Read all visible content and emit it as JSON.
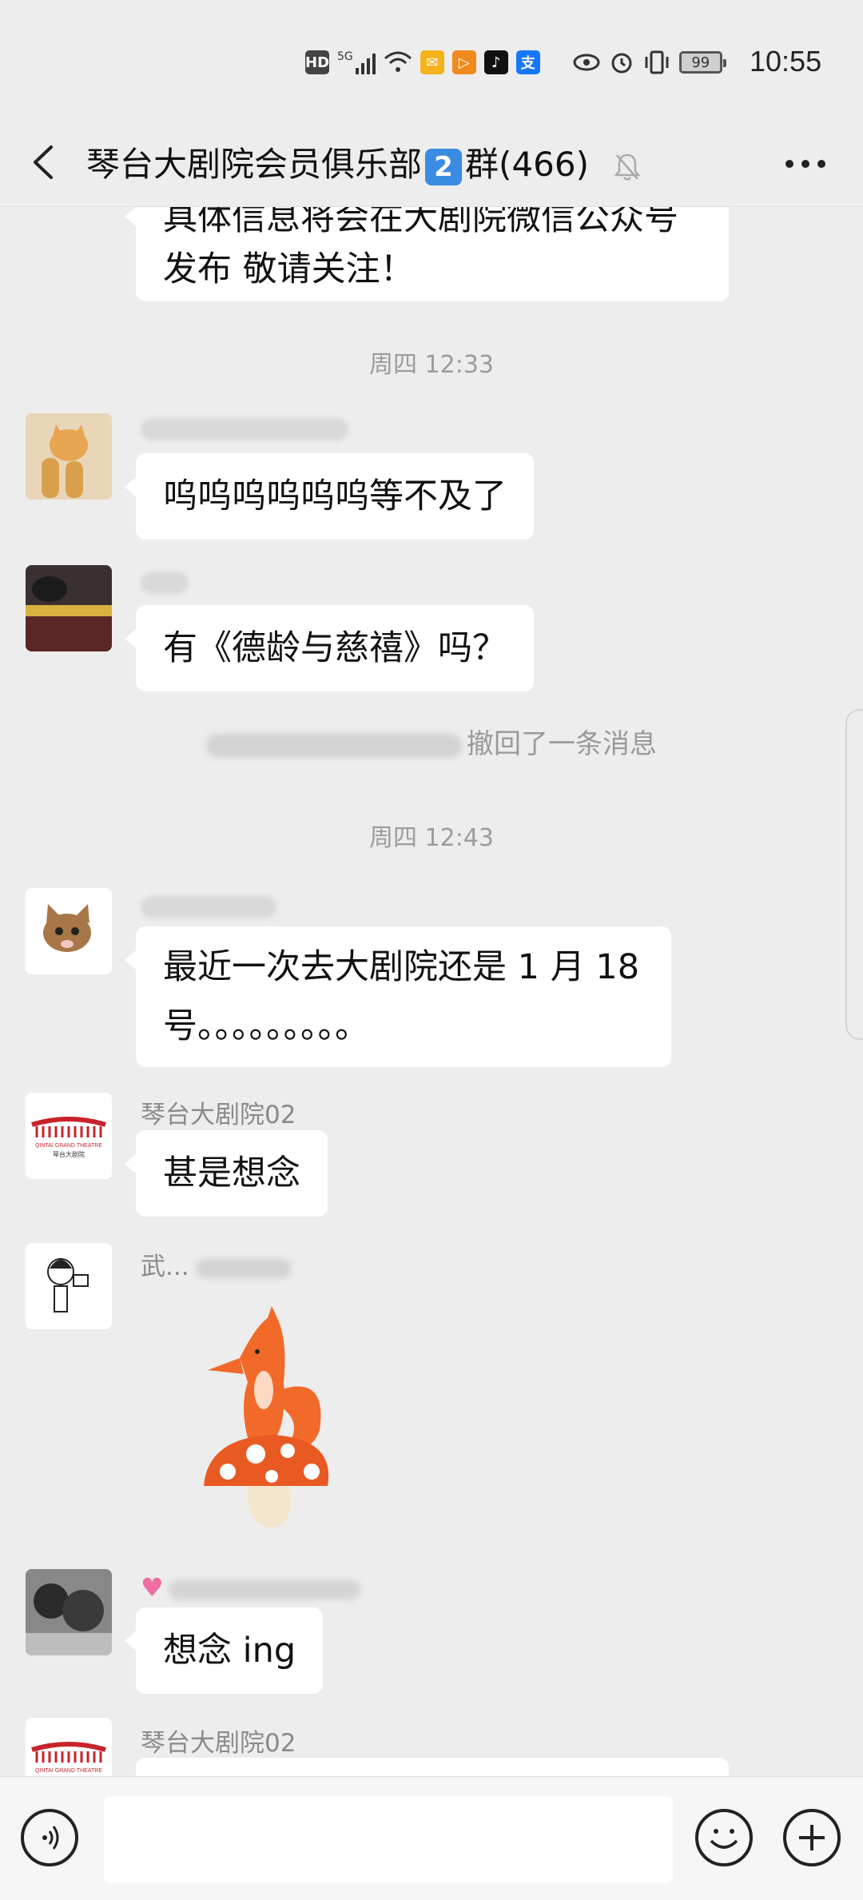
{
  "status_bar": {
    "hd": "HD",
    "net": "5G",
    "battery": "99",
    "time": "10:55",
    "app_icons": [
      "wifi-icon",
      "mail-icon",
      "video-icon",
      "tiktok-icon",
      "alipay-icon",
      "eye-icon",
      "alarm-icon",
      "vibrate-icon"
    ]
  },
  "header": {
    "title_prefix": "琴台大剧院会员俱乐部",
    "badge": "2",
    "title_suffix": "群(466)"
  },
  "messages": {
    "m0": {
      "text_line1": "具体信息将会在大剧院微信公众号",
      "text_line2": "发布 敬请关注！"
    },
    "t1": "周四 12:33",
    "m1": {
      "text": "呜呜呜呜呜呜等不及了"
    },
    "m2": {
      "text": "有《德龄与慈禧》吗？"
    },
    "recall": "撤回了一条消息",
    "t2": "周四 12:43",
    "m3": {
      "text_line1": "最近一次去大剧院还是 1 月 18",
      "text_line2": "号。。。。。。。。。"
    },
    "m4": {
      "name": "琴台大剧院02",
      "text": "甚是想念"
    },
    "m5": {
      "name_prefix": "武..."
    },
    "m6": {
      "text": "想念 ing"
    },
    "m7": {
      "name": "琴台大剧院02"
    }
  },
  "theatre_logo": {
    "line1": "QINTAI GRAND THEATRE",
    "line2": "琴台大剧院"
  },
  "colors": {
    "background": "#ededed",
    "bubble": "#ffffff",
    "badge": "#3a8be2",
    "theatre_red": "#c8232c"
  }
}
